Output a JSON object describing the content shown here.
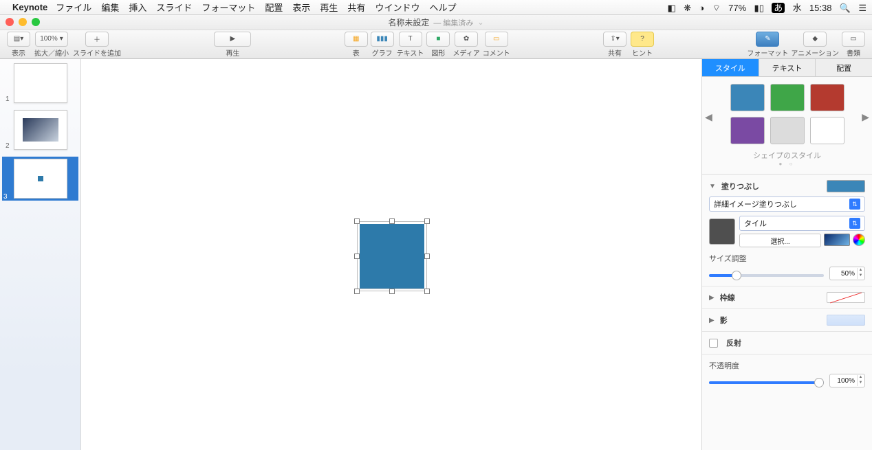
{
  "menubar": {
    "app": "Keynote",
    "items": [
      "ファイル",
      "編集",
      "挿入",
      "スライド",
      "フォーマット",
      "配置",
      "表示",
      "再生",
      "共有",
      "ウインドウ",
      "ヘルプ"
    ],
    "battery": "77%",
    "ime": "あ",
    "clock_day": "水",
    "clock_time": "15:38"
  },
  "window": {
    "title": "名称未設定",
    "edited": "— 編集済み"
  },
  "toolbar": {
    "view": "表示",
    "zoom_value": "100%",
    "zoom_label": "拡大／縮小",
    "add_slide": "スライドを追加",
    "play": "再生",
    "table": "表",
    "chart": "グラフ",
    "text": "テキスト",
    "shape": "図形",
    "media": "メディア",
    "comment": "コメント",
    "share": "共有",
    "hint": "ヒント",
    "format": "フォーマット",
    "animate": "アニメーション",
    "document": "書類"
  },
  "nav": {
    "slides": [
      "1",
      "2",
      "3"
    ],
    "selected": 3
  },
  "inspector": {
    "tabs": {
      "style": "スタイル",
      "text": "テキスト",
      "arrange": "配置"
    },
    "shape_styles_label": "シェイプのスタイル",
    "swatches": [
      "#3b86b8",
      "#3fa648",
      "#b43a2f",
      "#7a4aa3",
      "#dcdcdc",
      "#ffffff"
    ],
    "fill": {
      "label": "塗りつぶし",
      "type": "詳細イメージ塗りつぶし",
      "tile": "タイル",
      "choose": "選択...",
      "size_label": "サイズ調整",
      "size_value": "50%"
    },
    "border": {
      "label": "枠線"
    },
    "shadow": {
      "label": "影"
    },
    "reflect": {
      "label": "反射"
    },
    "opacity": {
      "label": "不透明度",
      "value": "100%"
    }
  }
}
